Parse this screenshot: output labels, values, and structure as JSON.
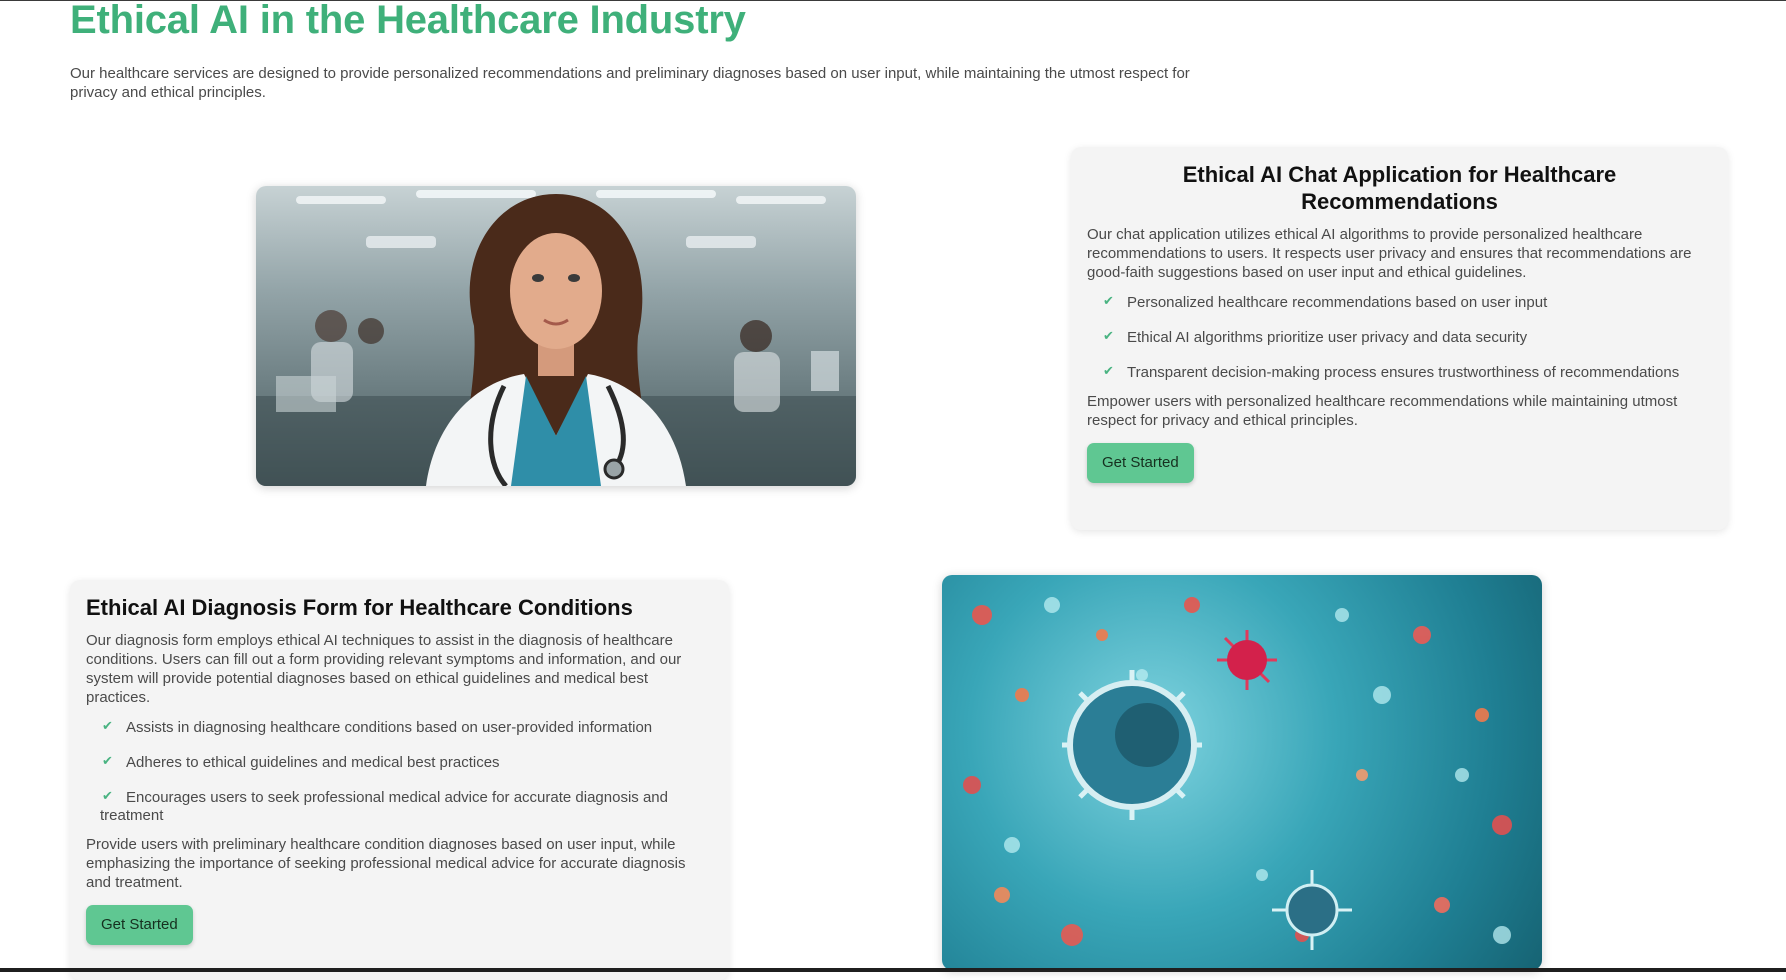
{
  "page": {
    "title": "Ethical AI in the Healthcare Industry",
    "intro": "Our healthcare services are designed to provide personalized recommendations and preliminary diagnoses based on user input, while maintaining the utmost respect for privacy and ethical principles.",
    "accent_color": "#3fb07a"
  },
  "chat_card": {
    "title": "Ethical AI Chat Application for Healthcare Recommendations",
    "description": "Our chat application utilizes ethical AI algorithms to provide personalized healthcare recommendations to users. It respects user privacy and ensures that recommendations are good-faith suggestions based on user input and ethical guidelines.",
    "features": [
      "Personalized healthcare recommendations based on user input",
      "Ethical AI algorithms prioritize user privacy and data security",
      "Transparent decision-making process ensures trustworthiness of recommendations"
    ],
    "note": "Empower users with personalized healthcare recommendations while maintaining utmost respect for privacy and ethical principles.",
    "button_label": "Get Started"
  },
  "diagnosis_card": {
    "title": "Ethical AI Diagnosis Form for Healthcare Conditions",
    "description": "Our diagnosis form employs ethical AI techniques to assist in the diagnosis of healthcare conditions. Users can fill out a form providing relevant symptoms and information, and our system will provide potential diagnoses based on ethical guidelines and medical best practices.",
    "features": [
      "Assists in diagnosing healthcare conditions based on user-provided information",
      "Adheres to ethical guidelines and medical best practices",
      "Encourages users to seek professional medical advice for accurate diagnosis and treatment"
    ],
    "note": "Provide users with preliminary healthcare condition diagnoses based on user input, while emphasizing the importance of seeking professional medical advice for accurate diagnosis and treatment.",
    "button_label": "Get Started"
  },
  "icons": {
    "check": "check-icon"
  },
  "colors": {
    "button_bg": "#5fc792",
    "card_bg": "#f4f4f4",
    "check": "#49b381"
  }
}
